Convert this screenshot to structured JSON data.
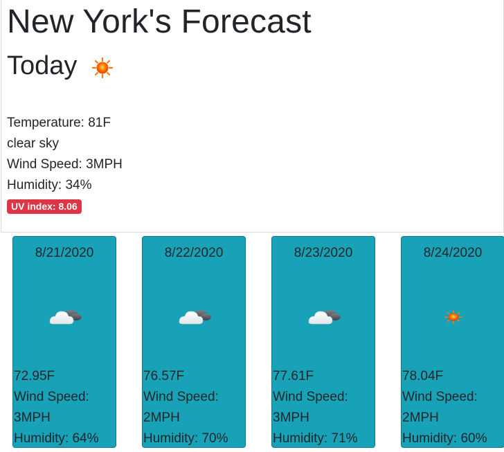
{
  "header": {
    "title": "New York's Forecast"
  },
  "today": {
    "heading": "Today",
    "icon": "sun-icon",
    "temperature": "Temperature: 81F",
    "description": "clear sky",
    "wind_speed": "Wind Speed: 3MPH",
    "humidity": "Humidity: 34%",
    "uv_badge": "UV index: 8.06",
    "uv_color": "#dc3545"
  },
  "forecast": [
    {
      "date": "8/21/2020",
      "icon": "cloudy-icon",
      "temperature": "72.95F",
      "wind_label": "Wind Speed:",
      "wind_value": "3MPH",
      "humidity": "Humidity: 64%"
    },
    {
      "date": "8/22/2020",
      "icon": "cloudy-icon",
      "temperature": "76.57F",
      "wind_label": "Wind Speed:",
      "wind_value": "2MPH",
      "humidity": "Humidity: 70%"
    },
    {
      "date": "8/23/2020",
      "icon": "cloudy-icon",
      "temperature": "77.61F",
      "wind_label": "Wind Speed:",
      "wind_value": "3MPH",
      "humidity": "Humidity: 71%"
    },
    {
      "date": "8/24/2020",
      "icon": "sun-icon",
      "temperature": "78.04F",
      "wind_label": "Wind Speed:",
      "wind_value": "2MPH",
      "humidity": "Humidity: 60%"
    }
  ],
  "colors": {
    "card_background": "#17a2b8",
    "text": "#212529"
  }
}
